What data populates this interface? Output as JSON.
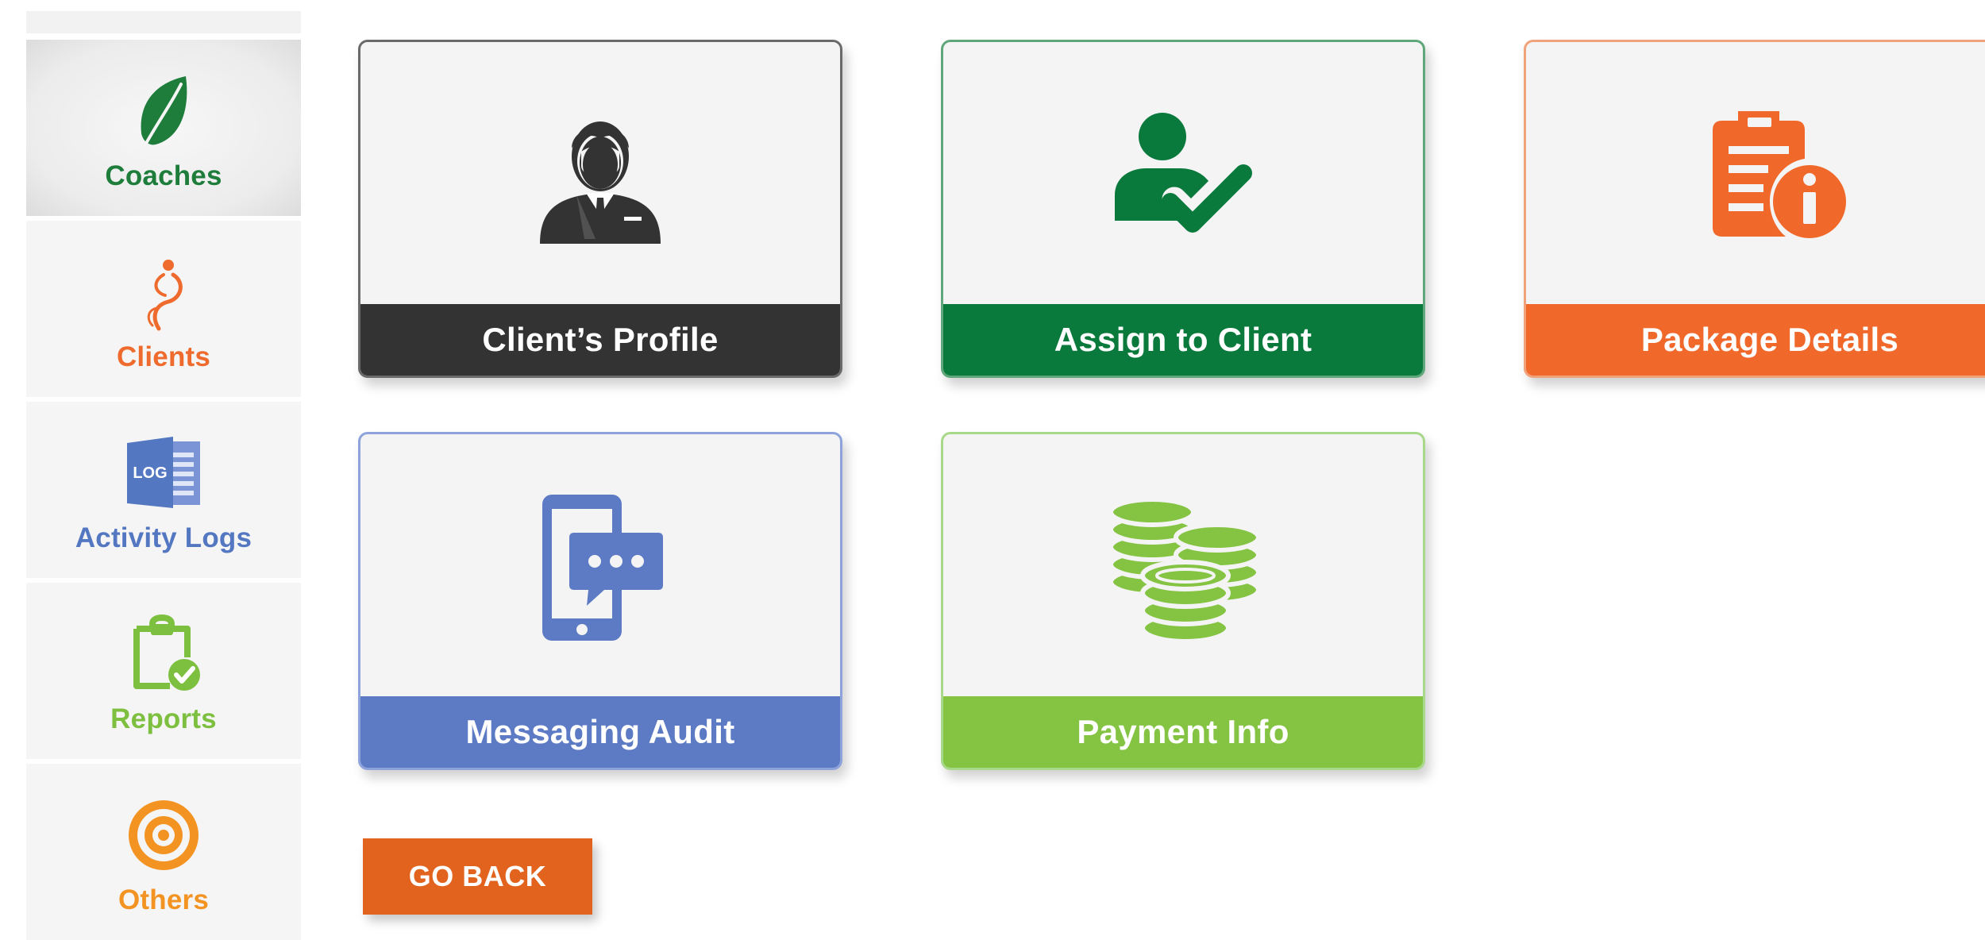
{
  "sidebar": {
    "items": [
      {
        "label": "Coaches",
        "icon": "leaf-icon",
        "color": "#1e7d3b",
        "active": true
      },
      {
        "label": "Clients",
        "icon": "person-swirl-icon",
        "color": "#ef6b2d",
        "active": false
      },
      {
        "label": "Activity Logs",
        "icon": "log-book-icon",
        "color": "#5477c2",
        "icon_text": "LOG",
        "active": false
      },
      {
        "label": "Reports",
        "icon": "clipboard-check-icon",
        "color": "#7dbf3f",
        "active": false
      },
      {
        "label": "Others",
        "icon": "target-icon",
        "color": "#f39322",
        "active": false
      }
    ]
  },
  "cards": [
    {
      "label": "Client’s Profile",
      "icon": "businessman-icon",
      "color": "#333333"
    },
    {
      "label": "Assign to Client",
      "icon": "user-check-icon",
      "color": "#0a7a3c"
    },
    {
      "label": "Package Details",
      "icon": "document-info-icon",
      "color": "#f0682a"
    },
    {
      "label": "Messaging Audit",
      "icon": "phone-chat-icon",
      "color": "#5d7bc4"
    },
    {
      "label": "Payment Info",
      "icon": "coin-stack-icon",
      "color": "#84c442"
    }
  ],
  "go_back": {
    "label": "GO BACK",
    "color": "#e2631e"
  }
}
